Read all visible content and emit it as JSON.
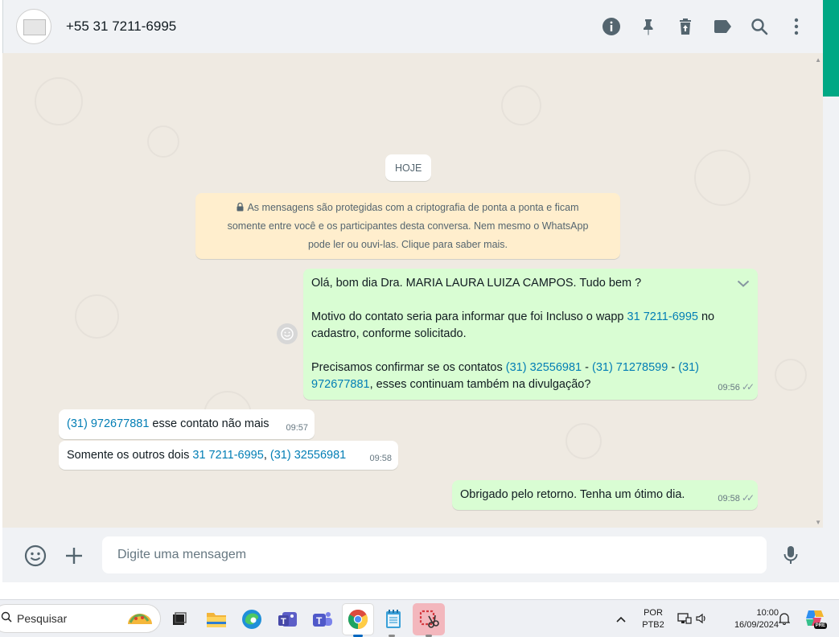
{
  "header": {
    "contact_name": "+55 31 7211-6995",
    "icons": [
      "info-icon",
      "pin-icon",
      "delete-icon",
      "label-icon",
      "search-icon",
      "menu-icon"
    ]
  },
  "chat": {
    "date_label": "HOJE",
    "encryption_notice": {
      "line1": "As mensagens são protegidas com a criptografia de ponta a ponta e ficam",
      "line2": "somente entre você e os participantes desta conversa. Nem mesmo o WhatsApp",
      "line3": "pode ler ou ouvi-las. Clique para saber mais."
    },
    "messages": [
      {
        "direction": "out",
        "greeting": "Olá, bom dia Dra. MARIA LAURA LUIZA CAMPOS. Tudo bem ?",
        "p2_pre": "Motivo do contato seria para informar que foi Incluso o wapp ",
        "p2_link": "31 7211-6995",
        "p2_post": " no",
        "p2_line2": "cadastro, conforme solicitado.",
        "p3_pre": "Precisamos confirmar se os contatos  ",
        "p3_link1": "(31) 32556981",
        "p3_sep1": " - ",
        "p3_link2": "(31) 71278599",
        "p3_sep2": " - ",
        "p3_link3a": "(31)",
        "p3_link3b": "972677881",
        "p3_post": ", esses continuam também na divulgação?",
        "time": "09:56",
        "status": "read"
      },
      {
        "direction": "in",
        "link": "(31) 972677881",
        "text": " esse contato não mais",
        "time": "09:57"
      },
      {
        "direction": "in",
        "pre": "Somente os outros dois ",
        "link1": "31 7211-6995",
        "sep": ", ",
        "link2": "(31) 32556981",
        "time": "09:58"
      },
      {
        "direction": "out",
        "text": "Obrigado pelo retorno. Tenha um ótimo dia.",
        "time": "09:58",
        "status": "read"
      }
    ]
  },
  "input": {
    "placeholder": "Digite uma mensagem",
    "value": ""
  },
  "taskbar": {
    "search_label": "Pesquisar",
    "apps": [
      "task-view",
      "file-explorer",
      "edge",
      "teams-classic",
      "teams",
      "chrome",
      "notepad",
      "snipping-tool"
    ],
    "language": "POR",
    "layout": "PTB2",
    "time": "10:00",
    "date": "16/09/2024",
    "copilot_badge": "PRE"
  },
  "colors": {
    "outgoing_bubble": "#d9fdd3",
    "incoming_bubble": "#ffffff",
    "chat_background": "#efeae2",
    "link": "#027eb5",
    "accent": "#00a884"
  }
}
